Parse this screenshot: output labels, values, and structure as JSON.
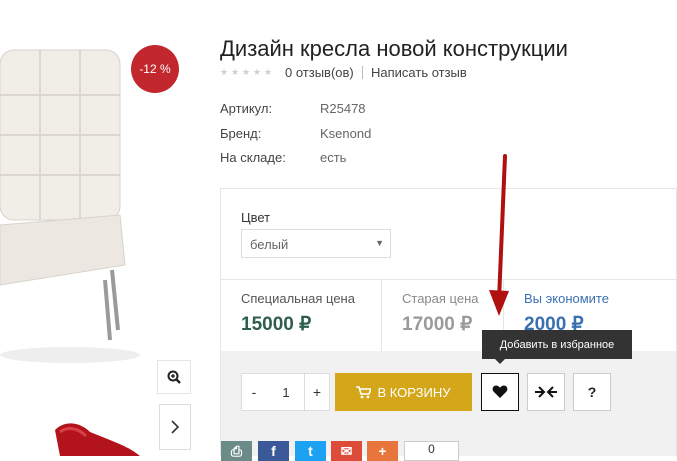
{
  "product": {
    "title": "Дизайн кресла новой конструкции",
    "discount_badge": "-12 %",
    "reviews_text": "0 отзыв(ов)",
    "write_review": "Написать отзыв",
    "rating": 0
  },
  "attributes": [
    {
      "label": "Артикул:",
      "value": "R25478"
    },
    {
      "label": "Бренд:",
      "value": "Ksenond"
    },
    {
      "label": "На складе:",
      "value": "есть"
    }
  ],
  "options": {
    "color_label": "Цвет",
    "color_selected": "белый"
  },
  "prices": {
    "special_label": "Специальная цена",
    "special_value": "15000 ₽",
    "old_label": "Старая цена",
    "old_value": "17000 ₽",
    "save_label": "Вы экономите",
    "save_value": "2000 ₽"
  },
  "cart": {
    "minus": "-",
    "quantity": "1",
    "plus": "+",
    "add_to_cart": "В КОРЗИНУ",
    "question": "?"
  },
  "tooltip": "Добавить в избранное",
  "share": {
    "count": "0"
  },
  "colors": {
    "accent": "#d4a61a",
    "discount": "#c1272d",
    "price_special": "#2e5e4e",
    "arrow": "#b01010"
  },
  "icons": [
    "magnifier-plus-icon",
    "chevron-right-icon",
    "shopping-cart-icon",
    "heart-icon",
    "compare-icon",
    "print-icon",
    "facebook-icon",
    "twitter-icon",
    "gmail-icon",
    "plus-icon"
  ]
}
